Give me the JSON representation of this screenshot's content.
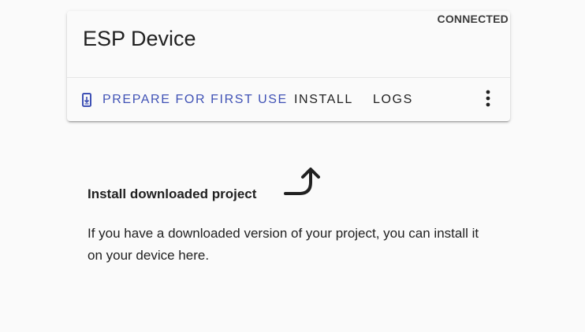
{
  "device": {
    "title": "ESP Device",
    "status": "CONNECTED"
  },
  "actions": {
    "prepare": {
      "label": "PREPARE FOR FIRST USE",
      "icon": "phone-download-icon"
    },
    "install": {
      "label": "INSTALL"
    },
    "logs": {
      "label": "LOGS"
    },
    "menu": {
      "icon": "more-vertical-icon"
    }
  },
  "hint": {
    "title": "Install downloaded project",
    "body": "If you have a downloaded version of your project, you can install it on your device here.",
    "icon": "curved-arrow-up-icon"
  },
  "colors": {
    "primary": "#3f51b5",
    "background": "#fafafa",
    "text": "#212121"
  }
}
